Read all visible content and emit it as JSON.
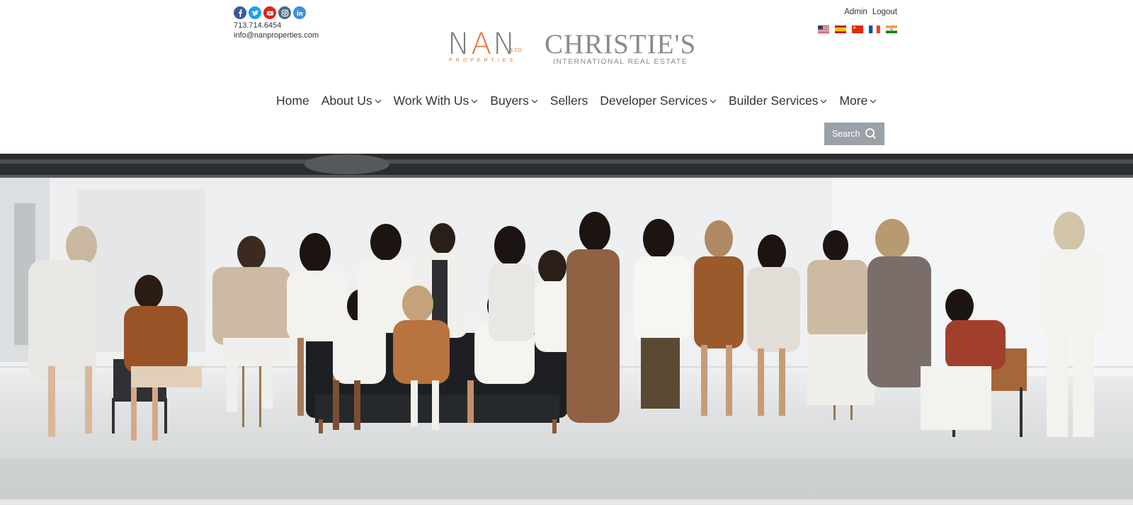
{
  "contact": {
    "social": [
      {
        "name": "facebook",
        "color": "#3b5998"
      },
      {
        "name": "twitter",
        "color": "#1da1f2"
      },
      {
        "name": "youtube",
        "color": "#e62117"
      },
      {
        "name": "instagram",
        "color": "#4a6a8a"
      },
      {
        "name": "linkedin",
        "color": "#3c91d8"
      }
    ],
    "phone": "713.714.6454",
    "email": "info@nanproperties.com"
  },
  "logos": {
    "nan_left": "N",
    "nan_mid": "A",
    "nan_right": "N",
    "nan_co": "& CO",
    "nan_sub": "PROPERTIES",
    "christies_name": "CHRISTIE'S",
    "christies_sub": "INTERNATIONAL REAL ESTATE"
  },
  "top_links": {
    "admin": "Admin",
    "logout": "Logout"
  },
  "flags": [
    "english",
    "spanish",
    "chinese",
    "french",
    "hindi"
  ],
  "nav": [
    {
      "label": "Home",
      "dropdown": false
    },
    {
      "label": "About Us",
      "dropdown": true
    },
    {
      "label": "Work With Us",
      "dropdown": true
    },
    {
      "label": "Buyers",
      "dropdown": true
    },
    {
      "label": "Sellers",
      "dropdown": false
    },
    {
      "label": "Developer Services",
      "dropdown": true
    },
    {
      "label": "Builder Services",
      "dropdown": true
    },
    {
      "label": "More",
      "dropdown": true
    }
  ],
  "search": {
    "label": "Search"
  },
  "colors": {
    "accent_orange": "#e3753a",
    "search_bg": "#9aa1a7",
    "logo_gray": "#8a8a8a"
  }
}
